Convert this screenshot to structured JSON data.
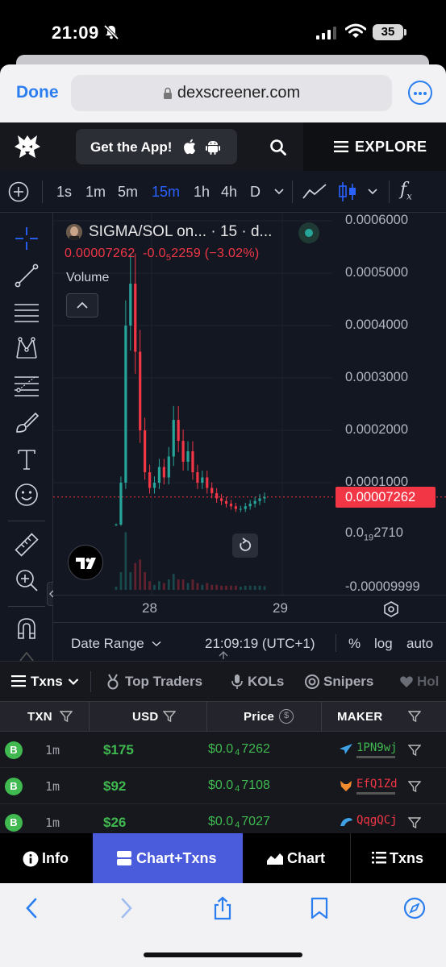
{
  "status_bar": {
    "time": "21:09",
    "battery": "35"
  },
  "safari": {
    "done_label": "Done",
    "url": "dexscreener.com"
  },
  "dex_header": {
    "get_app_label": "Get the App!",
    "explore_label": "EXPLORE"
  },
  "chart_toolbar": {
    "timeframes": [
      "1s",
      "1m",
      "5m",
      "15m",
      "1h",
      "4h",
      "D"
    ],
    "active_timeframe": "15m",
    "fx_label": "f"
  },
  "legend": {
    "title": "SIGMA/SOL on... · 15 · d...",
    "price": "0.00007262",
    "change": "-0.0",
    "change_sub": "5",
    "change_rest": "2259 (−3.02%)",
    "volume_label": "Volume"
  },
  "price_axis": {
    "labels": [
      "0.0006000",
      "0.0005000",
      "0.0004000",
      "0.0003000",
      "0.0002000",
      "0.0001000"
    ],
    "current_price": "0.00007262",
    "low_label_prefix": "0.0",
    "low_label_sub": "19",
    "low_label_rest": "2710",
    "bottom_label": "-0.00009999"
  },
  "time_axis": {
    "labels": [
      "28",
      "29"
    ]
  },
  "chart_bottom": {
    "date_range_label": "Date Range",
    "clock": "21:09:19 (UTC+1)",
    "percent_label": "%",
    "log_label": "log",
    "auto_label": "auto"
  },
  "chart_data": {
    "type": "candlestick",
    "title": "SIGMA/SOL on... · 15 · d...",
    "ylim": [
      -9.999e-05,
      0.0006
    ],
    "y_ticks": [
      0.0001,
      0.0002,
      0.0003,
      0.0004,
      0.0005,
      0.0006
    ],
    "x_ticks": [
      "28",
      "29"
    ],
    "last_price": 7.262e-05,
    "close_series": [
      2e-05,
      0.0001,
      0.0004,
      0.00048,
      0.00035,
      0.0002,
      0.00012,
      9e-05,
      0.0001,
      0.00013,
      0.00011,
      0.00015,
      0.00022,
      0.00018,
      0.00014,
      0.00016,
      0.00012,
      0.0001,
      0.00011,
      9e-05,
      8e-05,
      7e-05,
      6.5e-05,
      6e-05,
      5.5e-05,
      5e-05,
      5e-05,
      5.5e-05,
      6e-05,
      6.5e-05,
      7e-05,
      7.262e-05
    ]
  },
  "tabs": [
    {
      "label": "Txns"
    },
    {
      "label": "Top Traders"
    },
    {
      "label": "KOLs"
    },
    {
      "label": "Snipers"
    },
    {
      "label": "Hol"
    }
  ],
  "table": {
    "headers": [
      "TXN",
      "USD",
      "Price",
      "MAKER"
    ],
    "rows": [
      {
        "type": "B",
        "age": "1m",
        "usd": "$175",
        "price_prefix": "$0.0",
        "price_sub": "4",
        "price_rest": "7262",
        "maker": "1PN9wj",
        "maker_color": "#3fb950"
      },
      {
        "type": "B",
        "age": "1m",
        "usd": "$92",
        "price_prefix": "$0.0",
        "price_sub": "4",
        "price_rest": "7108",
        "maker": "EfQ1Zd",
        "maker_color": "#f23645"
      },
      {
        "type": "B",
        "age": "1m",
        "usd": "$26",
        "price_prefix": "$0.0",
        "price_sub": "4",
        "price_rest": "7027",
        "maker": "QqgQCj",
        "maker_color": "#f23645"
      }
    ]
  },
  "bottom_nav": {
    "info_label": "Info",
    "chart_txns_label": "Chart+Txns",
    "chart_label": "Chart",
    "txns_label": "Txns"
  },
  "colors": {
    "accent_blue": "#2962ff",
    "up_green": "#3fb950",
    "down_red": "#f23645",
    "nav_active": "#4a5bdb"
  }
}
